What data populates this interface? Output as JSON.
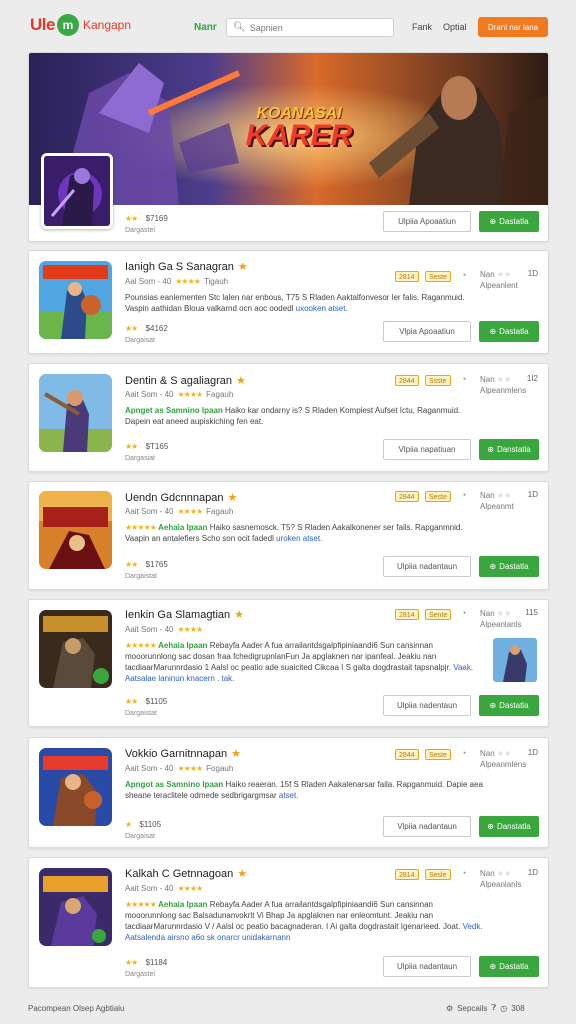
{
  "header": {
    "logo_left": "Ule",
    "logo_mark": "m",
    "logo_right": "Kangapn",
    "nav_main": "Nanr",
    "search_placeholder": "Sapnien",
    "nav_rank": "Fank",
    "nav_options": "Optial",
    "cta": "Dranl nar lana"
  },
  "featured": {
    "banner_title_top": "KOANASAI",
    "banner_title_main": "KARER",
    "stars": "★★",
    "rating_count": "$7169",
    "sub": "Dargastel",
    "secondary_button": "Ulpiia Apoaatiun",
    "primary_button": "Dastatla"
  },
  "apps": [
    {
      "title": "Ianigh Ga S Sanagran",
      "meta_a": "Aal Som - 40",
      "meta_stars": "★★★★",
      "meta_b": "Tigauh",
      "desc_highlight": "",
      "desc": "Pounsias eanlementen Stc lalen nar enbous, T75 S Rladen Aaktalfonvesor ler falis. Raganmuid. Vaspin aathidan Bloua valkarnd ocn aoc oodedl",
      "desc_link": "uxooken atset.",
      "badge_1": "2814",
      "badge_2": "Seste",
      "right_label": "Nan",
      "right_stars": "★★",
      "right_sub": "Alpeanlent",
      "right_num": "1D",
      "stars": "★★",
      "rating_count": "$4162",
      "sub": "Dargaisat",
      "secondary_button": "Vlpia Apoaatiun",
      "primary_button": "Dastatla"
    },
    {
      "title": "Dentin & S agaliagran",
      "meta_a": "Aait Som - 40",
      "meta_stars": "★★★★",
      "meta_b": "Fagauh",
      "desc_highlight": "Apnget as Samnino Ipaan",
      "desc": "Haiko kar ondarny is? S Rladen Kompiest Aufset Ictu, Raganmuid. Dapein eat aneed aupiskiching fen eat.",
      "desc_link": "",
      "badge_1": "2844",
      "badge_2": "Ssste",
      "right_label": "Nan",
      "right_stars": "★★",
      "right_sub": "Alpeanmlens",
      "right_num": "1I2",
      "stars": "★★",
      "rating_count": "$T165",
      "sub": "Dargasiat",
      "secondary_button": "Vlpiia napatiuan",
      "primary_button": "Danstatla"
    },
    {
      "title": "Uendn Gdcnnnapan",
      "meta_a": "Aait Som - 40",
      "meta_stars": "★★★★",
      "meta_b": "Fagauh",
      "desc_highlight": "Aehaia Ipaan",
      "desc": "Haiko sasnemosck. T5? S Rladen Aakalkonener ser fails. Rapganmnid. Vaapin an antalefiers Scho son ocit fadedl",
      "desc_link": "uroken atset.",
      "badge_1": "2844",
      "badge_2": "Seste",
      "right_label": "Nan",
      "right_stars": "★★",
      "right_sub": "Alpeanmt",
      "right_num": "1D",
      "stars": "★★",
      "rating_count": "$1765",
      "sub": "Dargaistat",
      "secondary_button": "Ulpiia nadantaun",
      "primary_button": "Dastatla"
    },
    {
      "title": "Ienkin Ga Slamagtian",
      "meta_a": "Aait Som - 40",
      "meta_stars": "★★★★",
      "meta_b": "",
      "desc_highlight": "Aehaia Ipaan",
      "desc": "Rebayfa Aader A fua arrailantdsgalpfipiniaandi6 Sun cansinnan mooorunnlong sac dosan fraa fchedigrupnlanFun Ja apglaknen nar ipanfeal. Jeakiu nan tacdiaarMarunnrdasio 1 Aalsl oc peatio ade suaicited Cikcaa I S galta dogdrastait tapsnalpjr.",
      "desc_link": "Vaak. Aatsalae laninun knacern . tak.",
      "badge_1": "2814",
      "badge_2": "Sente",
      "right_label": "Nan",
      "right_stars": "★★",
      "right_sub": "Alpeanlanls",
      "right_num": "115",
      "stars": "★★",
      "rating_count": "$1105",
      "sub": "Dargaistat",
      "secondary_button": "Ulpiia nadentaun",
      "primary_button": "Dastatla"
    },
    {
      "title": "Vokkio Garnitnnapan",
      "meta_a": "Aait Som - 40",
      "meta_stars": "★★★★",
      "meta_b": "Fogauh",
      "desc_highlight": "Apngot as Samnino Ipaan",
      "desc": "Haiko reaeran. 15f S Rladen Aakalenarsar faila. Rapganmuid. Dapie aea sheane teraclitele odmede sedbrigargmsar",
      "desc_link": "atset.",
      "badge_1": "2844",
      "badge_2": "Seste",
      "right_label": "Nan",
      "right_stars": "★★",
      "right_sub": "Alpeanmlens",
      "right_num": "1D",
      "stars": "★",
      "rating_count": "$1105",
      "sub": "Dargaisat",
      "secondary_button": "Vlpiia nadantaun",
      "primary_button": "Danstatla"
    },
    {
      "title": "Kalkah C Getnnagoan",
      "meta_a": "Aait Som - 40",
      "meta_stars": "★★★★",
      "meta_b": "",
      "desc_highlight": "Aehaia Ipaan",
      "desc": "Rebayfa Aader A fua arrailantdsgalpfipiniaandi6 Sun cansinnan mooorunnlong sac Balsadunanvokrlt Vi Bhap Ja apglaknen nar enleomtunt. Jeakiu nan tacdiaarMarunnrdasio V / Aalsl oc peatio bacagnaderan. I Ai galta dogdrastait Igenarieed. Joat.",
      "desc_link": "Vedk. Aatsalenda airsno a6o sk onarcr unidakarnann",
      "badge_1": "2814",
      "badge_2": "Sesle",
      "right_label": "Nan",
      "right_stars": "★★",
      "right_sub": "Alpeanlanls",
      "right_num": "1D",
      "stars": "★★",
      "rating_count": "$1184",
      "sub": "Dargastel",
      "secondary_button": "Ulpiia nadantaun",
      "primary_button": "Dastatla"
    }
  ],
  "footer": {
    "left": "Pacompean Olsep Agbtiaiu",
    "right_a": "Sepcails",
    "right_b": "308"
  },
  "colors": {
    "accent_green": "#3aa63e",
    "accent_orange": "#f07a1f",
    "star_yellow": "#f2b417"
  }
}
